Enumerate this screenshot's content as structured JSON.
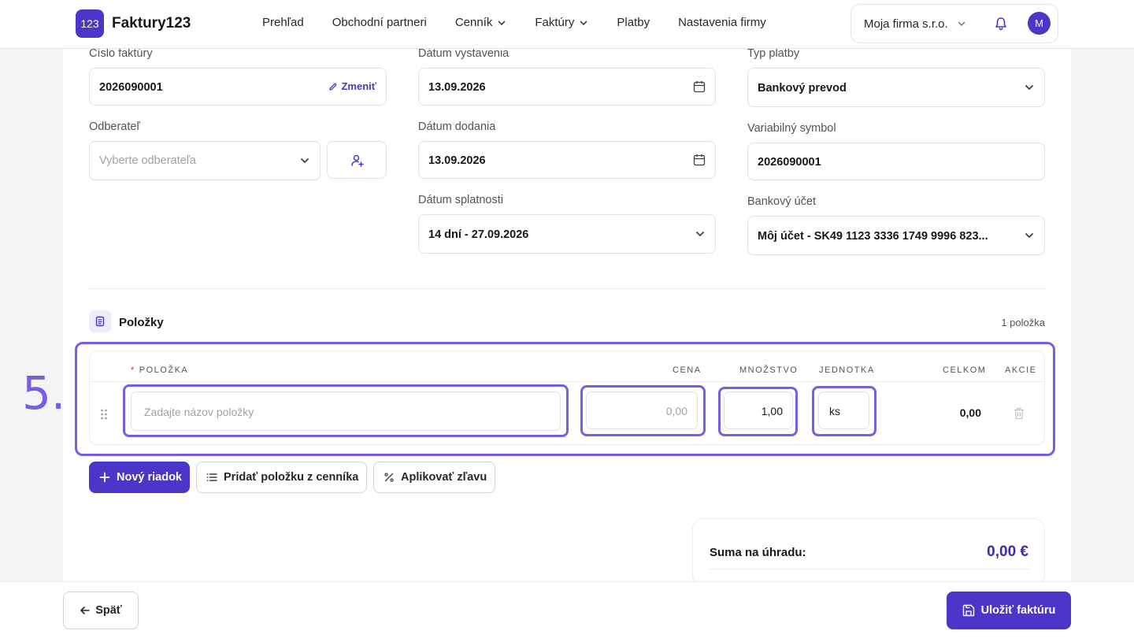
{
  "brand": {
    "badge": "123",
    "name": "Faktury123"
  },
  "nav": [
    {
      "label": "Prehľad",
      "dropdown": false
    },
    {
      "label": "Obchodní partneri",
      "dropdown": false
    },
    {
      "label": "Cenník",
      "dropdown": true
    },
    {
      "label": "Faktúry",
      "dropdown": true
    },
    {
      "label": "Platby",
      "dropdown": false
    },
    {
      "label": "Nastavenia firmy",
      "dropdown": false
    }
  ],
  "company": {
    "name": "Moja firma s.r.o.",
    "avatar_initial": "M"
  },
  "form": {
    "invoice_number": {
      "label": "Číslo faktúry",
      "value": "2026090001",
      "action": "Zmeniť"
    },
    "customer": {
      "label": "Odberateľ",
      "placeholder": "Vyberte odberateľa"
    },
    "issue_date": {
      "label": "Dátum vystavenia",
      "value": "13.09.2026"
    },
    "delivery_date": {
      "label": "Dátum dodania",
      "value": "13.09.2026"
    },
    "due_date": {
      "label": "Dátum splatnosti",
      "value": "14 dní - 27.09.2026"
    },
    "payment_type": {
      "label": "Typ platby",
      "value": "Bankový prevod"
    },
    "variable_symbol": {
      "label": "Variabilný symbol",
      "value": "2026090001"
    },
    "bank_account": {
      "label": "Bankový účet",
      "value": "Môj účet - SK49 1123 3336 1749 9996 823..."
    }
  },
  "items": {
    "title": "Položky",
    "count": "1 položka",
    "columns": {
      "item": "POLOŽKA",
      "price": "CENA",
      "qty": "MNOŽSTVO",
      "unit": "JEDNOTKA",
      "total": "CELKOM",
      "actions": "AKCIE"
    },
    "rows": [
      {
        "name_placeholder": "Zadajte názov položky",
        "price_placeholder": "0,00",
        "qty": "1,00",
        "unit": "ks",
        "total": "0,00"
      }
    ]
  },
  "step_label": "5.",
  "buttons": {
    "new_row": "Nový riadok",
    "add_from_pricelist": "Pridať položku z cenníka",
    "apply_discount": "Aplikovať zľavu",
    "back": "Späť",
    "save": "Uložiť faktúru"
  },
  "summary": {
    "label": "Suma na úhradu:",
    "value": "0,00 €"
  },
  "colors": {
    "accent": "#4c35c9",
    "highlight": "#7b5ce6"
  }
}
